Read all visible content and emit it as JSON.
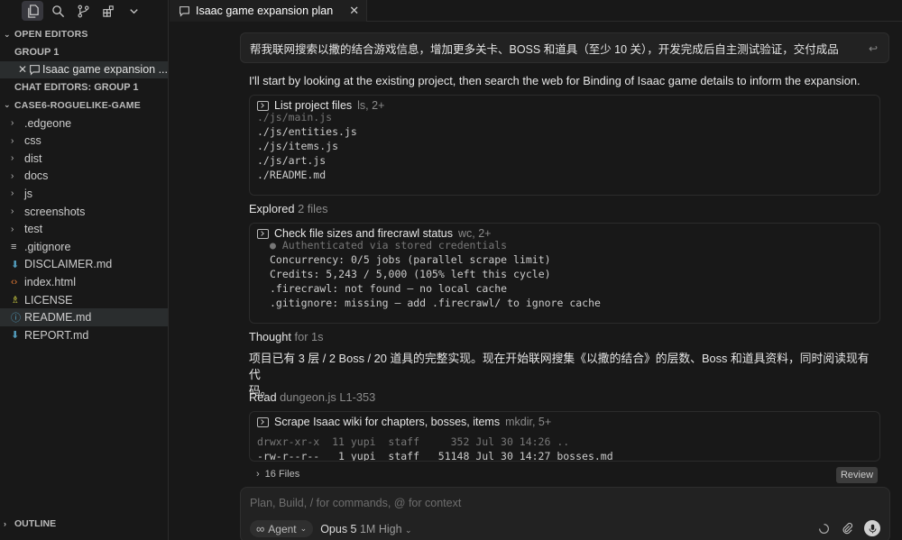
{
  "sidebar": {
    "open_editors_header": "OPEN EDITORS",
    "group1_label": "GROUP 1",
    "open_editor_item": "Isaac game expansion ...",
    "chat_editors_label": "CHAT EDITORS: GROUP 1",
    "project_header": "CASE6-ROGUELIKE-GAME",
    "tree": [
      {
        "name": ".edgeone",
        "type": "folder"
      },
      {
        "name": "css",
        "type": "folder"
      },
      {
        "name": "dist",
        "type": "folder"
      },
      {
        "name": "docs",
        "type": "folder"
      },
      {
        "name": "js",
        "type": "folder"
      },
      {
        "name": "screenshots",
        "type": "folder"
      },
      {
        "name": "test",
        "type": "folder"
      },
      {
        "name": ".gitignore",
        "type": "file",
        "icon": "lines-icon",
        "color": "#cccccc"
      },
      {
        "name": "DISCLAIMER.md",
        "type": "file",
        "icon": "markdown-arrow-icon",
        "color": "#519aba"
      },
      {
        "name": "index.html",
        "type": "file",
        "icon": "html-code-icon",
        "color": "#e37933"
      },
      {
        "name": "LICENSE",
        "type": "file",
        "icon": "license-person-icon",
        "color": "#cbcb41"
      },
      {
        "name": "README.md",
        "type": "file",
        "icon": "info-icon",
        "color": "#519aba",
        "selected": true
      },
      {
        "name": "REPORT.md",
        "type": "file",
        "icon": "markdown-arrow-icon",
        "color": "#519aba"
      }
    ],
    "outline_header": "OUTLINE"
  },
  "tab": {
    "title": "Isaac game expansion plan",
    "close": "✕"
  },
  "chat": {
    "user_message": "帮我联网搜索以撒的结合游戏信息，增加更多关卡、BOSS 和道具（至少 10 关），开发完成后自主测试验证，交付成品",
    "intro": "I'll start by looking at the existing project, then search the web for Binding of Isaac game details to inform the expansion.",
    "tool1": {
      "title": "List project files",
      "meta": "ls, 2+",
      "lines": [
        "./js/main.js",
        "./js/entities.js",
        "./js/items.js",
        "./js/art.js",
        "./README.md"
      ]
    },
    "explored": {
      "label": "Explored",
      "meta": "2 files"
    },
    "tool2": {
      "title": "Check file sizes and firecrawl status",
      "meta": "wc, 2+",
      "lines": [
        "● Authenticated via stored credentials",
        "Concurrency: 0/5 jobs (parallel scrape limit)",
        "Credits: 5,243 / 5,000 (105% left this cycle)",
        ".firecrawl: not found – no local cache",
        ".gitignore: missing – add .firecrawl/ to ignore cache"
      ]
    },
    "thought": {
      "label": "Thought",
      "meta": "for 1s"
    },
    "zh_line1": "项目已有 3 层 / 2 Boss / 20 道具的完整实现。现在开始联网搜集《以撒的结合》的层数、Boss 和道具资料，同时阅读现有代",
    "zh_line2": "码。",
    "read": {
      "label": "Read",
      "file": "dungeon.js",
      "range": "L1-353"
    },
    "tool3": {
      "title": "Scrape Isaac wiki for chapters, bosses, items",
      "meta": "mkdir, 5+",
      "lines": [
        "drwxr-xr-x  11 yupi  staff     352 Jul 30 14:26 ..",
        "-rw-r--r--   1 yupi  staff   51148 Jul 30 14:27 bosses.md"
      ]
    },
    "files_count": "16 Files",
    "review_label": "Review"
  },
  "composer": {
    "placeholder": "Plan, Build, / for commands, @ for context",
    "mode_label": "Agent",
    "model_name": "Opus 5",
    "model_meta": "1M High"
  },
  "colors": {
    "bg": "#181818",
    "sidebar_selected": "#2a2d2e",
    "card_border": "#2b2b2b"
  }
}
